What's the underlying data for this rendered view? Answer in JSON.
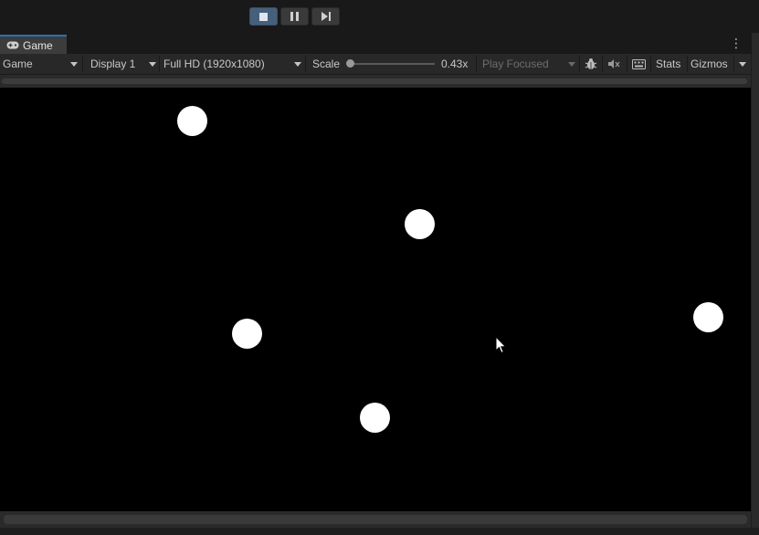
{
  "play_toolbar": {
    "buttons": [
      {
        "name": "stop-button",
        "icon": "stop-icon",
        "active": true
      },
      {
        "name": "pause-button",
        "icon": "pause-icon",
        "active": false
      },
      {
        "name": "step-button",
        "icon": "step-icon",
        "active": false
      }
    ]
  },
  "tab": {
    "icon": "gamepad-icon",
    "label": "Game",
    "menu_icon": "kebab-menu-icon"
  },
  "game_toolbar": {
    "view_mode": "Game",
    "display": "Display 1",
    "resolution": "Full HD (1920x1080)",
    "scale_label": "Scale",
    "scale_value": "0.43x",
    "play_mode": "Play Focused",
    "stats_label": "Stats",
    "gizmos_label": "Gizmos"
  },
  "viewport": {
    "background": "#000000",
    "ball_color": "#ffffff",
    "ball_count": 5
  },
  "colors": {
    "accent": "#2d6fb8",
    "active_button": "#46607c"
  }
}
